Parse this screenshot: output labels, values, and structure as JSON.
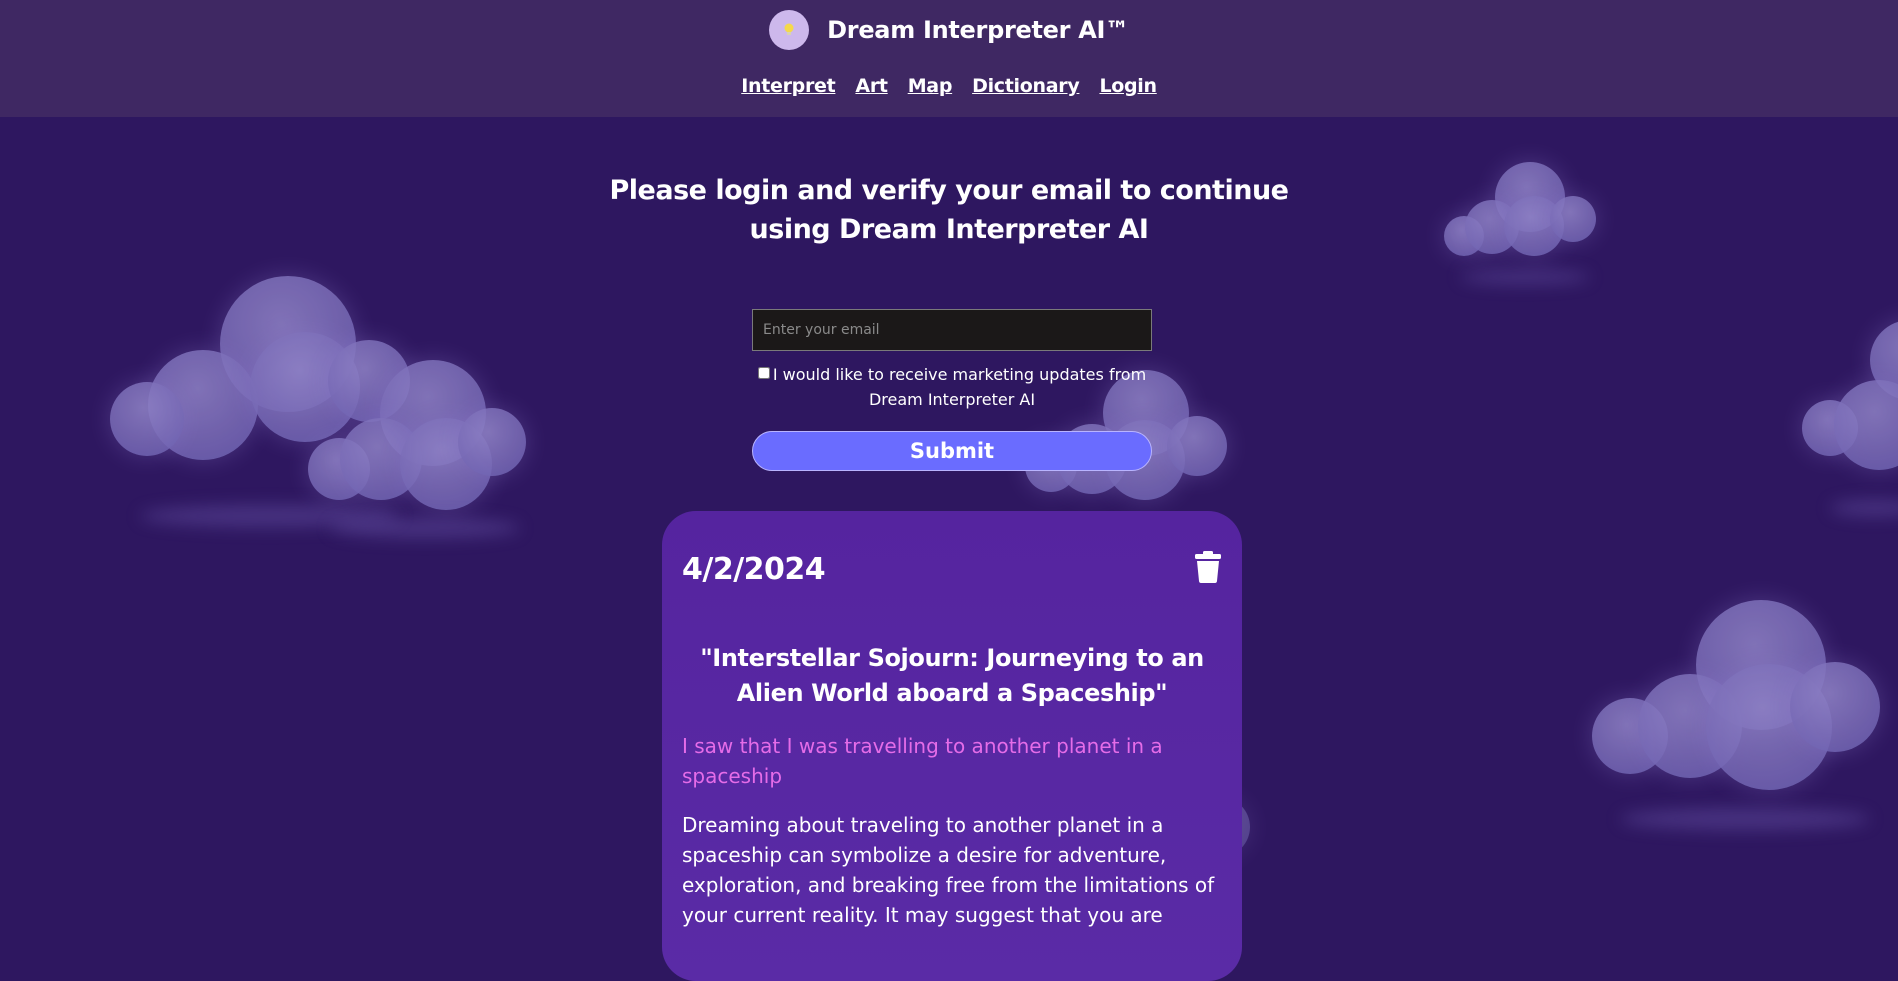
{
  "header": {
    "brand_title": "Dream Interpreter AI™",
    "logo_icon": "lightbulb-icon",
    "nav": [
      {
        "label": "Interpret"
      },
      {
        "label": "Art"
      },
      {
        "label": "Map"
      },
      {
        "label": "Dictionary"
      },
      {
        "label": "Login"
      }
    ]
  },
  "login": {
    "heading_line1": "Please login and verify your email to continue",
    "heading_line2": "using Dream Interpreter AI",
    "email_placeholder": "Enter your email",
    "email_value": "",
    "marketing_label": "I would like to receive marketing updates from Dream Interpreter AI",
    "marketing_checked": false,
    "submit_label": "Submit"
  },
  "dream": {
    "date": "4/2/2024",
    "title": "\"Interstellar Sojourn: Journeying to an Alien World aboard a Spaceship\"",
    "prompt": "I saw that I was travelling to another planet in a spaceship",
    "interpretation": "Dreaming about traveling to another planet in a spaceship can symbolize a desire for adventure, exploration, and breaking free from the limitations of your current reality. It may suggest that you are",
    "delete_icon": "trash-icon"
  },
  "colors": {
    "background": "#2e1760",
    "header": "#3f2863",
    "card": "#55249f",
    "accent_button": "#6a6cff",
    "prompt_text": "#e56ce8"
  }
}
